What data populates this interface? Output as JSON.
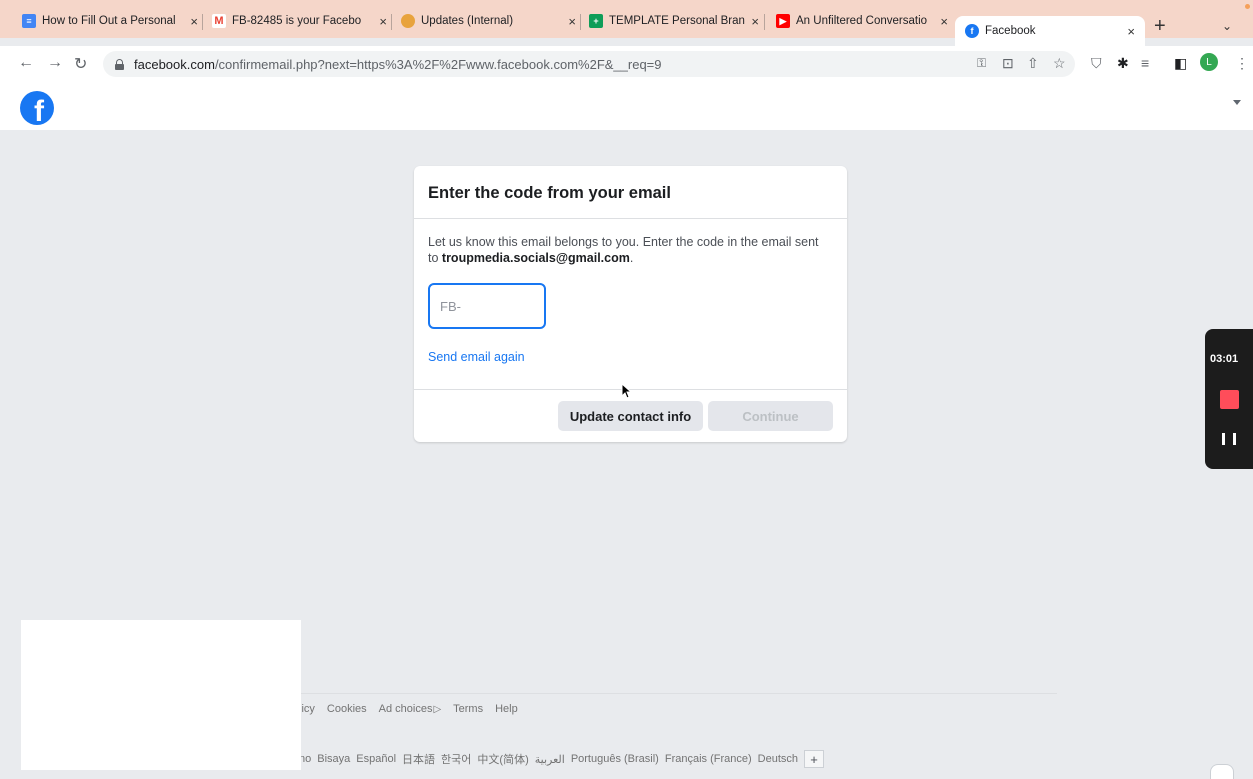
{
  "browser": {
    "tabs": [
      {
        "title": "How to Fill Out a Personal",
        "icon": "docs-icon",
        "color": "#4285f4"
      },
      {
        "title": "FB-82485 is your Facebo",
        "icon": "gmail-icon",
        "color": "#ea4335"
      },
      {
        "title": "Updates (Internal)",
        "icon": "emoji-icon",
        "color": "#e8a33d"
      },
      {
        "title": "TEMPLATE Personal Branc",
        "icon": "sheets-icon",
        "color": "#0f9d58"
      },
      {
        "title": "An Unfiltered Conversatio",
        "icon": "youtube-icon",
        "color": "#ff0000"
      },
      {
        "title": "Facebook",
        "icon": "facebook-icon",
        "color": "#1877f2",
        "active": true
      }
    ],
    "new_tab": "+",
    "tab_menu": "⌄",
    "url_host": "facebook.com",
    "url_rest": "/confirmemail.php?next=https%3A%2F%2Fwww.facebook.com%2F&__req=9",
    "profile_initial": "L"
  },
  "fb": {
    "logo": "f"
  },
  "dialog": {
    "title": "Enter the code from your email",
    "description": "Let us know this email belongs to you. Enter the code in the email sent to ",
    "email": "troupmedia.socials@gmail.com",
    "description_end": ".",
    "code_placeholder": "FB-",
    "resend_link": "Send email again",
    "update_button": "Update contact info",
    "continue_button": "Continue"
  },
  "recorder": {
    "time": "03:01"
  },
  "footer": {
    "links": [
      "licy",
      "Cookies",
      "Ad choices",
      "Terms",
      "Help"
    ],
    "languages": [
      "no",
      "Bisaya",
      "Español",
      "日本語",
      "한국어",
      "中文(简体)",
      "العربية",
      "Português (Brasil)",
      "Français (France)",
      "Deutsch"
    ],
    "more_languages": "+"
  },
  "colors": {
    "fb_blue": "#1877f2",
    "background": "#e9ebee",
    "record_red": "#ff4d5a"
  }
}
